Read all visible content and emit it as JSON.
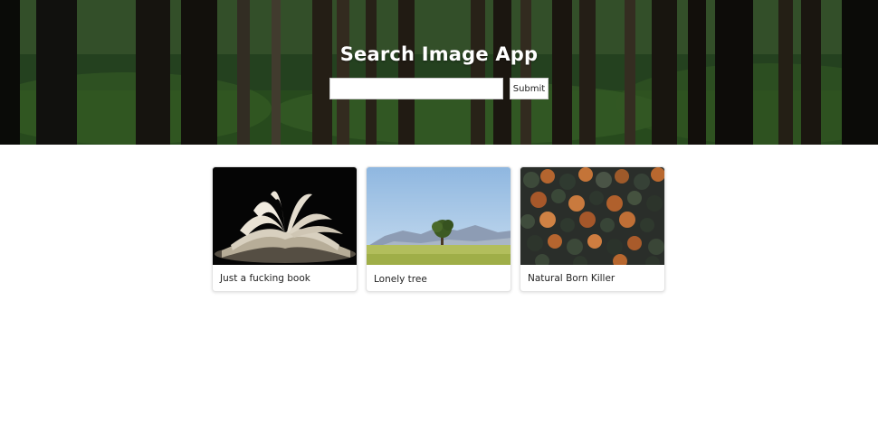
{
  "header": {
    "title": "Search Image App",
    "search": {
      "value": "",
      "placeholder": ""
    },
    "submit_label": "Submit"
  },
  "results": [
    {
      "caption": "Just a fucking book",
      "image": "open-book-photo"
    },
    {
      "caption": "Lonely tree",
      "image": "lonely-tree-photo"
    },
    {
      "caption": "Natural Born Killer",
      "image": "autumn-forest-photo"
    }
  ],
  "colors": {
    "hero_text": "#ffffff",
    "page_background": "#ffffff",
    "card_border": "#e3e3e3"
  }
}
